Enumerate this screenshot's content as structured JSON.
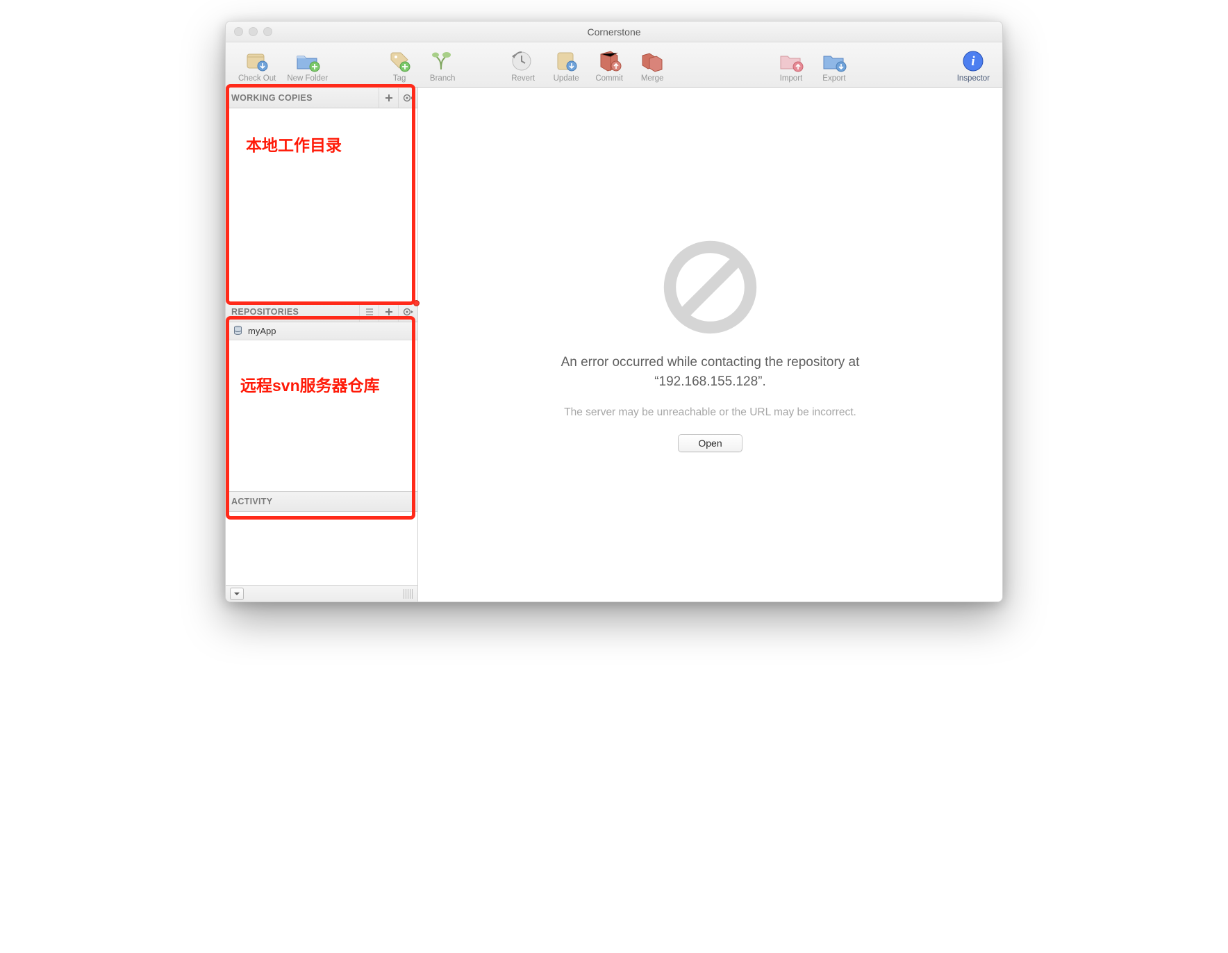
{
  "window": {
    "title": "Cornerstone"
  },
  "toolbar": {
    "checkout": "Check Out",
    "newfolder": "New Folder",
    "tag": "Tag",
    "branch": "Branch",
    "revert": "Revert",
    "update": "Update",
    "commit": "Commit",
    "merge": "Merge",
    "import": "Import",
    "export": "Export",
    "inspector": "Inspector"
  },
  "sidebar": {
    "working_copies_label": "WORKING COPIES",
    "repositories_label": "REPOSITORIES",
    "activity_label": "ACTIVITY",
    "repo_items": [
      {
        "name": "myApp"
      }
    ]
  },
  "main": {
    "error_line1": "An error occurred while contacting the repository at",
    "error_host_quoted": "“192.168.155.128”.",
    "error_sub": "The server may be unreachable or the URL may be incorrect.",
    "open_label": "Open"
  },
  "annotations": {
    "working_copies": "本地工作目录",
    "repositories": "远程svn服务器仓库"
  }
}
